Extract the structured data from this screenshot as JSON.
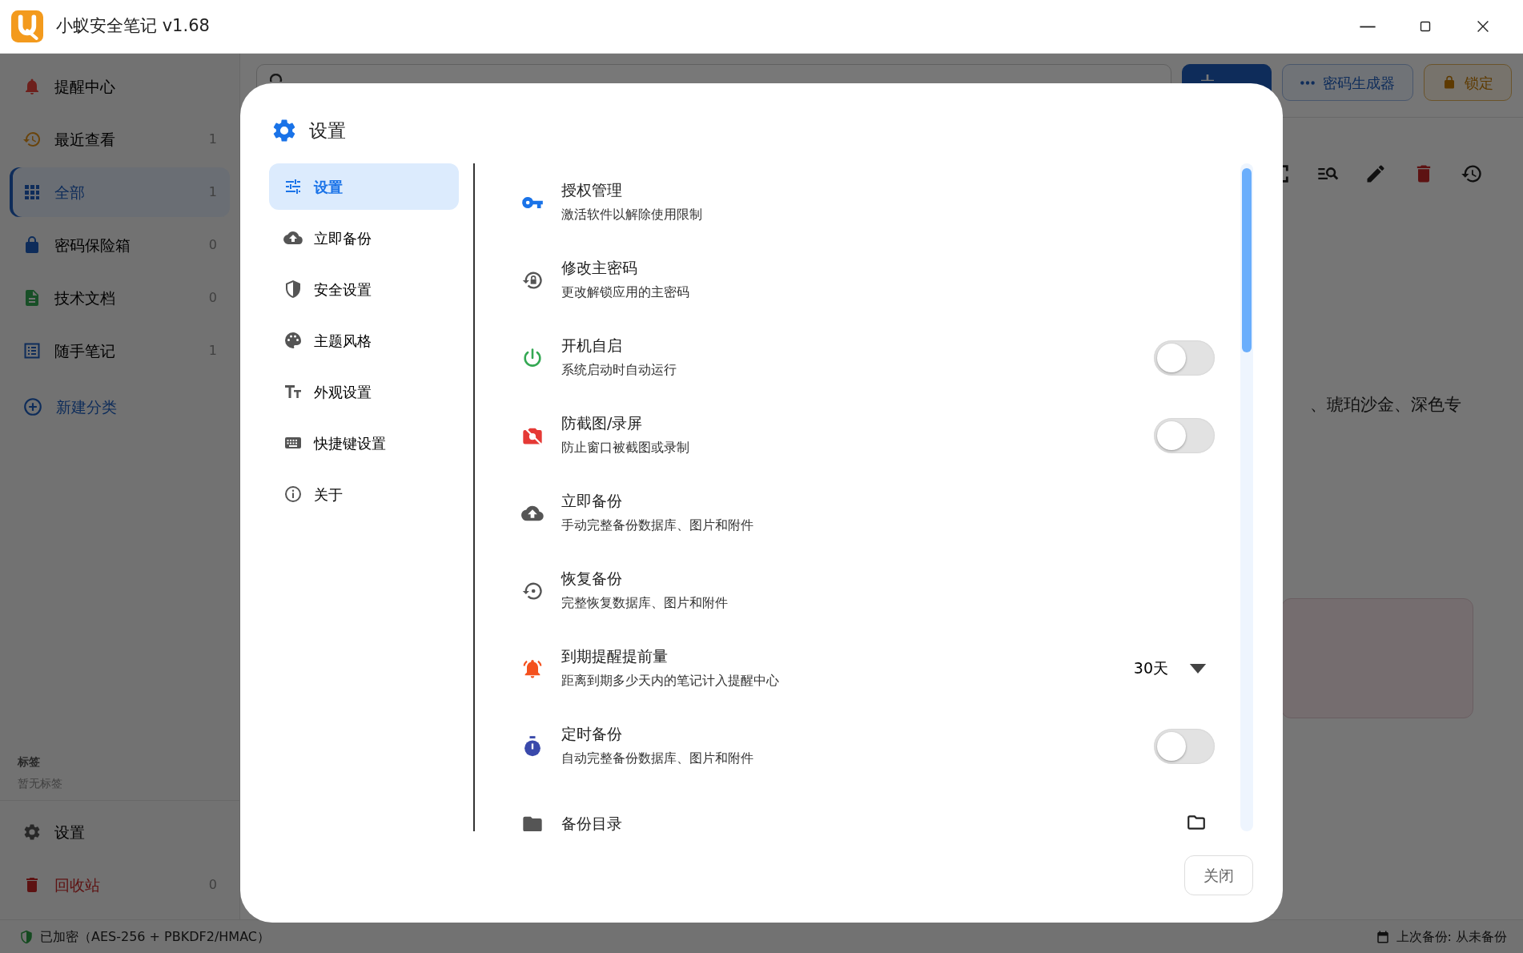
{
  "window": {
    "title": "小蚁安全笔记 v1.68"
  },
  "sidebar": {
    "items": [
      {
        "label": "提醒中心",
        "selected": false
      },
      {
        "label": "最近查看",
        "count": "1",
        "selected": false
      },
      {
        "label": "全部",
        "count": "1",
        "selected": true
      },
      {
        "label": "密码保险箱",
        "count": "0",
        "selected": false
      },
      {
        "label": "技术文档",
        "count": "0",
        "selected": false
      },
      {
        "label": "随手笔记",
        "count": "1",
        "selected": false
      }
    ],
    "add_category": "新建分类",
    "tags": {
      "heading": "标签",
      "empty_text": "暂无标签"
    },
    "bottom_items": [
      {
        "label": "设置",
        "kind": "normal"
      },
      {
        "label": "回收站",
        "count": "0",
        "kind": "danger"
      }
    ]
  },
  "toolbar": {
    "buttons": [
      {
        "kind": "primary"
      },
      {
        "label": "密码生成器",
        "kind": "outline"
      },
      {
        "label": "锁定",
        "kind": "warning"
      }
    ]
  },
  "note": {
    "text": "、琥珀沙金、深色专"
  },
  "dialog": {
    "title": "设置",
    "menu": [
      {
        "label": "设置",
        "selected": true
      },
      {
        "label": "立即备份",
        "selected": false
      },
      {
        "label": "安全设置",
        "selected": false
      },
      {
        "label": "主题风格",
        "selected": false
      },
      {
        "label": "外观设置",
        "selected": false
      },
      {
        "label": "快捷键设置",
        "selected": false
      },
      {
        "label": "关于",
        "selected": false
      }
    ],
    "settings": [
      {
        "kind": "link",
        "title": "授权管理",
        "subtitle": "激活软件以解除使用限制"
      },
      {
        "kind": "link",
        "title": "修改主密码",
        "subtitle": "更改解锁应用的主密码"
      },
      {
        "kind": "toggle",
        "title": "开机自启",
        "subtitle": "系统启动时自动运行",
        "on": false
      },
      {
        "kind": "toggle",
        "title": "防截图/录屏",
        "subtitle": "防止窗口被截图或录制",
        "on": false
      },
      {
        "kind": "link",
        "title": "立即备份",
        "subtitle": "手动完整备份数据库、图片和附件"
      },
      {
        "kind": "link",
        "title": "恢复备份",
        "subtitle": "完整恢复数据库、图片和附件"
      },
      {
        "kind": "select",
        "title": "到期提醒提前量",
        "subtitle": "距离到期多少天内的笔记计入提醒中心",
        "value": "30天"
      },
      {
        "kind": "toggle",
        "title": "定时备份",
        "subtitle": "自动完整备份数据库、图片和附件",
        "on": false
      },
      {
        "kind": "folder",
        "title": "备份目录"
      }
    ],
    "close_button": "关闭"
  },
  "status_bar": {
    "left": "已加密（AES-256 + PBKDF2/HMAC）",
    "right": "上次备份: 从未备份"
  }
}
